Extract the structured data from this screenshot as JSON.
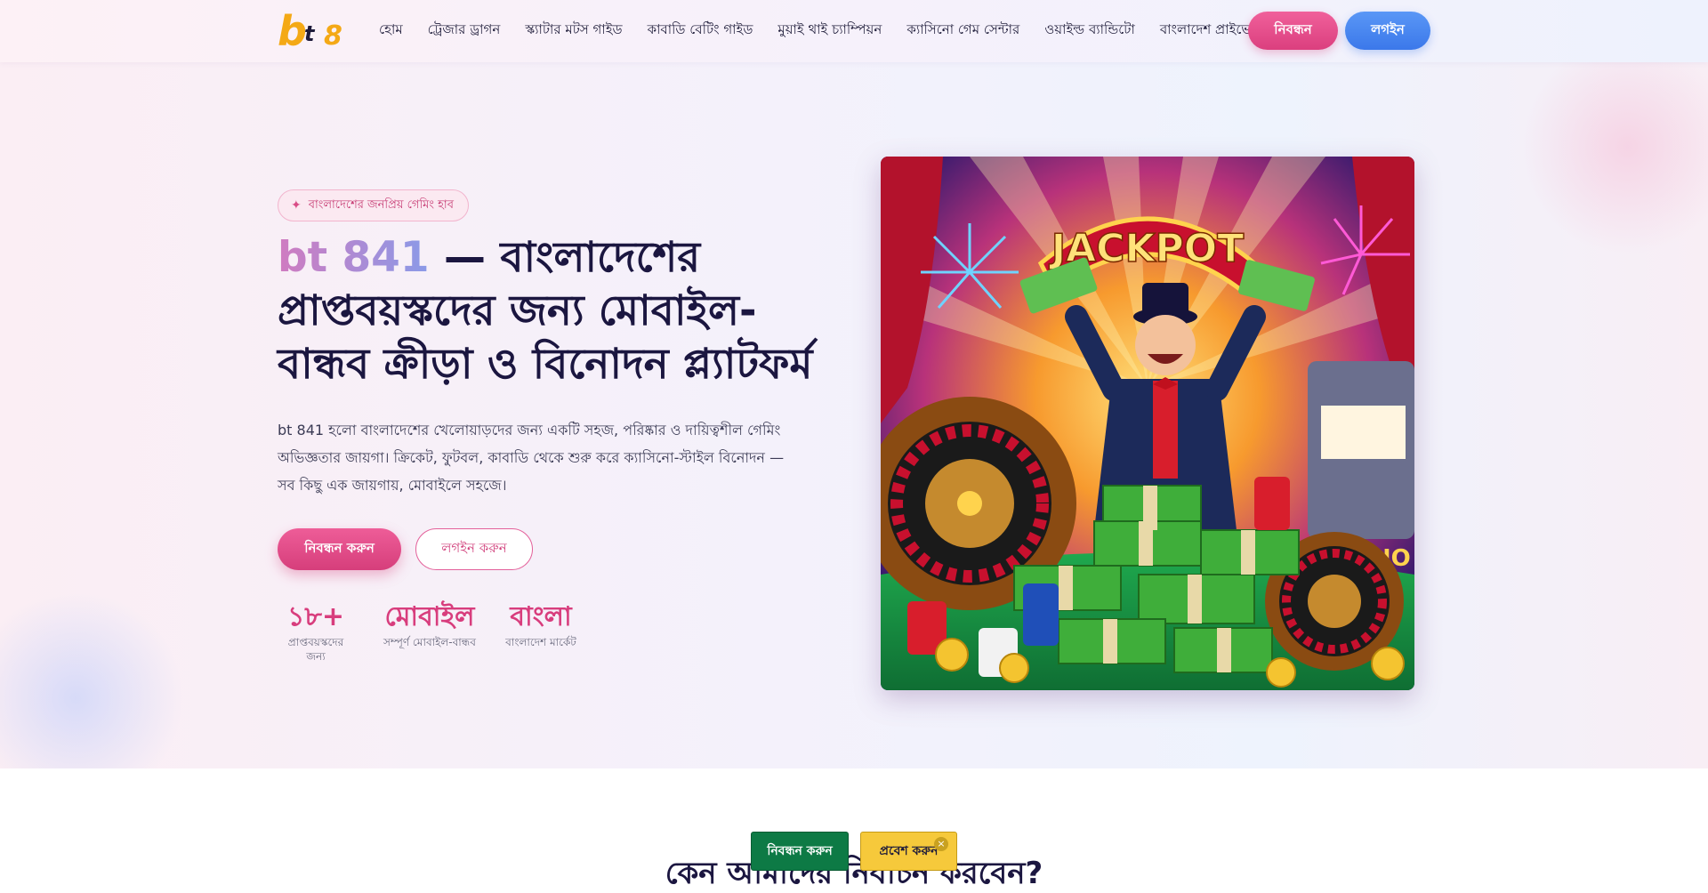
{
  "header": {
    "logo": {
      "b": "b",
      "t": "t",
      "n": "8"
    },
    "nav": [
      {
        "label": "হোম"
      },
      {
        "label": "ট্রেজার ড্রাগন"
      },
      {
        "label": "স্ক্যাটার মটস গাইড"
      },
      {
        "label": "কাবাডি বেটিং গাইড"
      },
      {
        "label": "মুয়াই থাই চ্যাম্পিয়ন"
      },
      {
        "label": "ক্যাসিনো গেম সেন্টার"
      },
      {
        "label": "ওয়াইল্ড ব্যান্ডিটো"
      },
      {
        "label": "বাংলাদেশ প্রাইভেসি গাইড"
      }
    ],
    "register_label": "নিবন্ধন",
    "login_label": "লগইন"
  },
  "hero": {
    "badge": "বাংলাদেশের জনপ্রিয় গেমিং হাব",
    "headline_brand": "bt 841",
    "headline_rest": " — বাংলাদেশের প্রাপ্তবয়স্কদের জন্য মোবাইল-বান্ধব ক্রীড়া ও বিনোদন প্ল্যাটফর্ম",
    "description": "bt 841 হলো বাংলাদেশের খেলোয়াড়দের জন্য একটি সহজ, পরিষ্কার ও দায়িত্বশীল গেমিং অভিজ্ঞতার জায়গা। ক্রিকেট, ফুটবল, কাবাডি থেকে শুরু করে ক্যাসিনো-স্টাইল বিনোদন — সব কিছু এক জায়গায়, মোবাইলে সহজে।",
    "register_button": "নিবন্ধন করুন",
    "login_button": "লগইন করুন",
    "stats": [
      {
        "value": "১৮+",
        "label": "প্রাপ্তবয়স্কদের জন্য"
      },
      {
        "value": "মোবাইল",
        "label": "সম্পূর্ণ মোবাইল-বান্ধব"
      },
      {
        "value": "বাংলা",
        "label": "বাংলাদেশ মার্কেট"
      }
    ],
    "image": {
      "jackpot_text": "JACKPOT",
      "casino_text": "CASINO"
    }
  },
  "section": {
    "title": "কেন আমাদের নির্বাচন করবেন?"
  },
  "floating_bar": {
    "register": "নিবন্ধন করুন",
    "enter": "প্রবেশ করুন",
    "close": "×"
  },
  "colors": {
    "accent_pink": "#d83d7d",
    "accent_blue": "#3b78ea",
    "gold": "#f4a916",
    "float_green": "#0d7a45",
    "float_yellow": "#f6c93b"
  }
}
